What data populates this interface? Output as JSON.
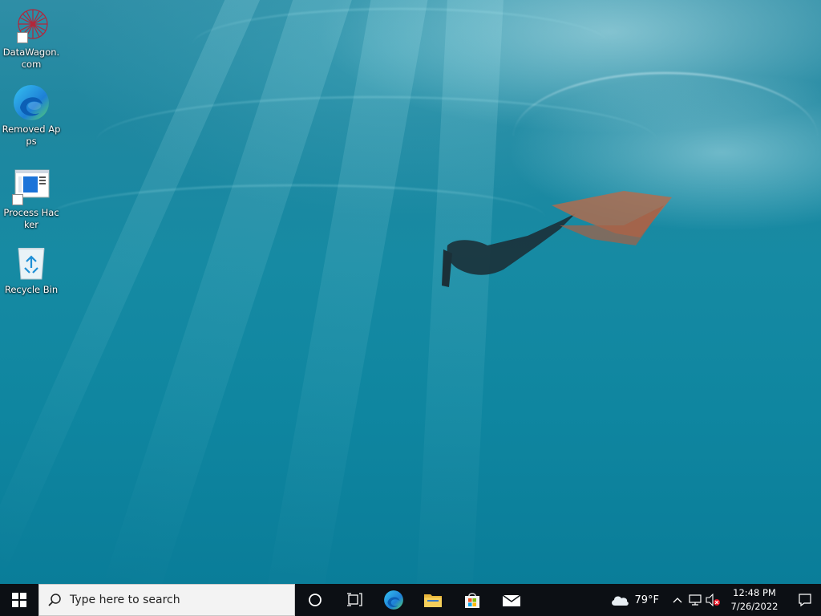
{
  "desktop": {
    "icons": [
      {
        "label": "DataWagon.com",
        "icon": "datawagon-icon"
      },
      {
        "label": "Removed Apps",
        "icon": "edge-icon"
      },
      {
        "label": "Process Hacker",
        "icon": "process-hacker-icon"
      },
      {
        "label": "Recycle Bin",
        "icon": "recycle-bin-icon"
      }
    ]
  },
  "taskbar": {
    "search_placeholder": "Type here to search",
    "weather_temp": "79°F",
    "time": "12:48 PM",
    "date": "7/26/2022"
  },
  "colors": {
    "taskbar_bg": "#0c0f14",
    "water": "#168aa3"
  }
}
